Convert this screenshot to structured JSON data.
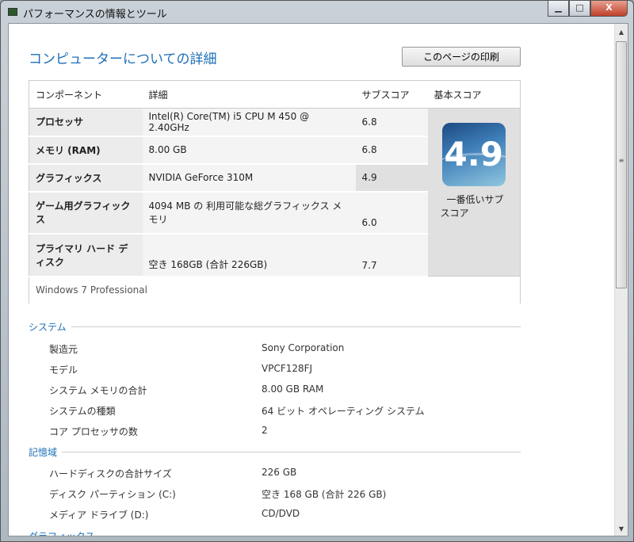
{
  "window": {
    "title": "パフォーマンスの情報とツール",
    "min": "▁",
    "max": "□",
    "close": "X"
  },
  "page": {
    "heading": "コンピューターについての詳細",
    "print_button": "このページの印刷"
  },
  "table": {
    "headers": [
      "コンポーネント",
      "詳細",
      "サブスコア",
      "基本スコア"
    ],
    "rows": [
      {
        "component": "プロセッサ",
        "detail": "Intel(R) Core(TM) i5 CPU M 450 @ 2.40GHz",
        "subscore": "6.8"
      },
      {
        "component": "メモリ (RAM)",
        "detail": "8.00 GB",
        "subscore": "6.8"
      },
      {
        "component": "グラフィックス",
        "detail": "NVIDIA GeForce 310M",
        "subscore": "4.9"
      },
      {
        "component": "ゲーム用グラフィックス",
        "detail": "4094 MB の 利用可能な総グラフィックス メモリ",
        "subscore": "6.0"
      },
      {
        "component": "プライマリ ハード ディスク",
        "detail": "空き 168GB (合計 226GB)",
        "subscore": "7.7"
      }
    ],
    "base_score": "4.9",
    "base_caption": "一番低いサブスコア",
    "footer": "Windows 7 Professional"
  },
  "system": {
    "title": "システム",
    "items": [
      {
        "label": "製造元",
        "value": "Sony Corporation"
      },
      {
        "label": "モデル",
        "value": "VPCF128FJ"
      },
      {
        "label": "システム メモリの合計",
        "value": "8.00 GB RAM"
      },
      {
        "label": "システムの種類",
        "value": "64 ビット オペレーティング システム"
      },
      {
        "label": "コア プロセッサの数",
        "value": "2"
      }
    ]
  },
  "storage": {
    "title": "記憶域",
    "items": [
      {
        "label": "ハードディスクの合計サイズ",
        "value": "226 GB"
      },
      {
        "label": "ディスク パーティション (C:)",
        "value": "空き 168 GB (合計 226 GB)"
      },
      {
        "label": "メディア ドライブ (D:)",
        "value": "CD/DVD"
      }
    ]
  },
  "graphics": {
    "title": "グラフィックス"
  }
}
